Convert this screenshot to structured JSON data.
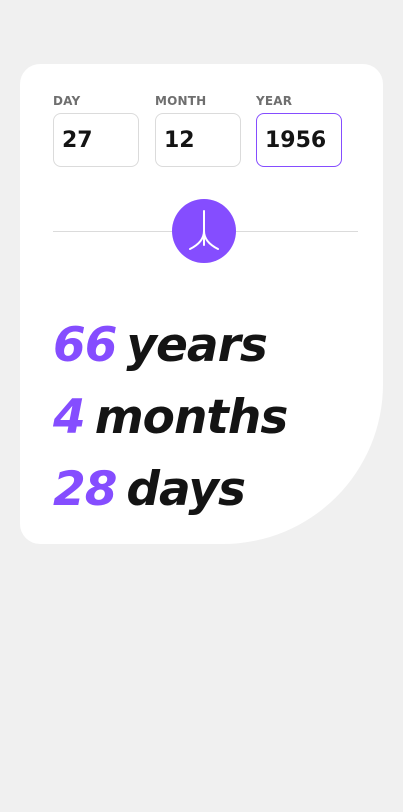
{
  "colors": {
    "accent": "#854dff",
    "text": "#141414",
    "label": "#6f6f6f",
    "border": "#dbdbdb",
    "background": "#f0f0f0",
    "card": "#ffffff"
  },
  "form": {
    "day": {
      "label": "DAY",
      "value": "27"
    },
    "month": {
      "label": "MONTH",
      "value": "12"
    },
    "year": {
      "label": "YEAR",
      "value": "1956"
    },
    "submit_icon": "arrow-down-icon"
  },
  "result": {
    "years": {
      "value": "66",
      "unit": "years"
    },
    "months": {
      "value": "4",
      "unit": "months"
    },
    "days": {
      "value": "28",
      "unit": "days"
    }
  }
}
